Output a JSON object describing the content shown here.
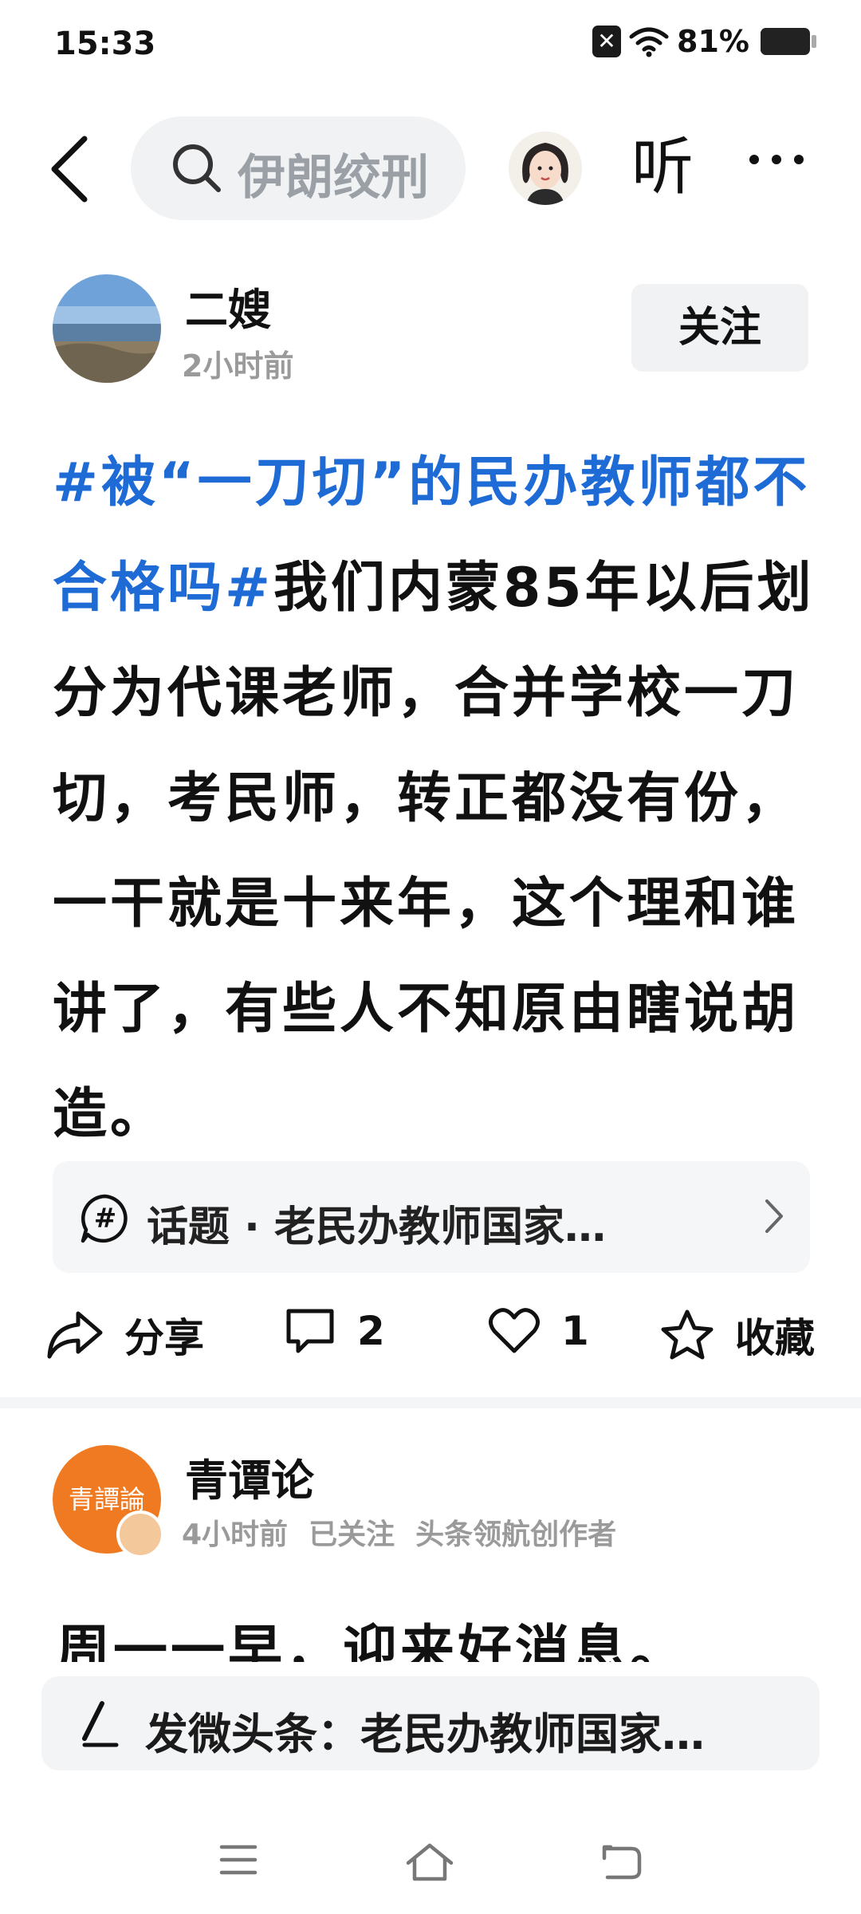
{
  "status_bar": {
    "time": "15:33",
    "battery_percent": "81%",
    "battery_level": 0.81
  },
  "top_nav": {
    "search_text": "伊朗绞刑",
    "listen_label": "听"
  },
  "post1": {
    "author": "二嫂",
    "time": "2小时前",
    "follow_label": "关注",
    "hashtag": "#被“一刀切”的民办教师都不合格吗#",
    "body": "我们内蒙85年以后划分为代课老师，合并学校一刀切，考民师，转正都没有份，一干就是十来年，这个理和谁讲了，有些人不知原由瞎说胡造。",
    "topic": "话题 · 老民办教师国家…",
    "actions": {
      "share": "分享",
      "comments": "2",
      "likes": "1",
      "collect": "收藏"
    }
  },
  "post2": {
    "author": "青谭论",
    "avatar_text": "青譚論",
    "time": "4小时前",
    "follow_status": "已关注",
    "author_tag": "头条领航创作者",
    "body_preview": "周一一早，迎来好消息。"
  },
  "compose": {
    "label": "发微头条：老民办教师国家…"
  },
  "colors": {
    "hashtag_blue": "#1e6bd6",
    "avatar_orange": "#f07a22"
  }
}
